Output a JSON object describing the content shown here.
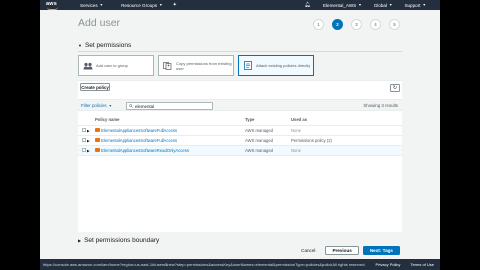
{
  "nav": {
    "brand": "aws",
    "services": "Services",
    "resource_groups": "Resource Groups",
    "account": "Elemental_AWS",
    "region": "Global",
    "support": "Support"
  },
  "page": {
    "title": "Add user",
    "steps": [
      "1",
      "2",
      "3",
      "4",
      "5"
    ],
    "active_step": 2
  },
  "sections": {
    "permissions": "Set permissions",
    "boundary": "Set permissions boundary"
  },
  "options": [
    {
      "label": "Add user to group"
    },
    {
      "label": "Copy permissions from existing user"
    },
    {
      "label": "Attach existing policies directly"
    }
  ],
  "toolbar": {
    "create_policy": "Create policy",
    "refresh": "↻"
  },
  "filter": {
    "label": "Filter policies",
    "search_value": "elemental",
    "showing": "Showing 3 results"
  },
  "table": {
    "headers": [
      "Policy name",
      "Type",
      "Used as"
    ],
    "rows": [
      {
        "name": "ElementalAppliancesSoftwareFullAccess",
        "type": "AWS managed",
        "used": "None"
      },
      {
        "name": "ElementalAppliancesSoftwareFullAccess",
        "type": "AWS managed",
        "used": "Permissions policy (2)"
      },
      {
        "name": "ElementalAppliancesSoftwareReadOnlyAccess",
        "type": "AWS managed",
        "used": "None"
      }
    ]
  },
  "footer": {
    "cancel": "Cancel",
    "previous": "Previous",
    "next": "Next: Tags"
  },
  "statusbar": {
    "url": "https://console.aws.amazon.com/iam/home?region=us-east-1#/users$new?step=permissions&accessKey&userNames=elemental&permissionType=policies&policies=arn:aws:iam::aws:policy%2FElementalAppliancesSoftwareReadOnlyAccess",
    "rights": "All rights reserved.",
    "privacy": "Privacy Policy",
    "terms": "Terms of Use"
  },
  "colors": {
    "nav_bg": "#232f3e",
    "primary": "#0073bb",
    "policy_icon": "#ec7211",
    "page_bg": "#f2f3f3"
  }
}
